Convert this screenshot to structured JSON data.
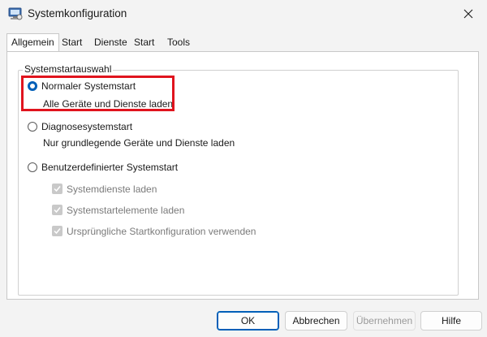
{
  "window": {
    "title": "Systemkonfiguration",
    "icon": "system-config-icon",
    "close_icon": "close-icon"
  },
  "tabs": [
    {
      "label": "Allgemein",
      "active": true
    },
    {
      "label": "Start",
      "active": false
    },
    {
      "label": "Dienste",
      "active": false
    },
    {
      "label": "Start",
      "active": false
    },
    {
      "label": "Tools",
      "active": false
    }
  ],
  "group": {
    "legend": "Systemstartauswahl"
  },
  "options": {
    "normal": {
      "label": "Normaler Systemstart",
      "desc": "Alle Geräte und Dienste laden",
      "selected": true
    },
    "diagnose": {
      "label": "Diagnosesystemstart",
      "desc": "Nur grundlegende Geräte und Dienste laden",
      "selected": false
    },
    "custom": {
      "label": "Benutzerdefinierter Systemstart",
      "selected": false
    }
  },
  "checkboxes": [
    {
      "label": "Systemdienste laden",
      "checked": true,
      "disabled": true
    },
    {
      "label": "Systemstartelemente laden",
      "checked": true,
      "disabled": true
    },
    {
      "label": "Ursprüngliche Startkonfiguration verwenden",
      "checked": true,
      "disabled": true
    }
  ],
  "buttons": {
    "ok": "OK",
    "cancel": "Abbrechen",
    "apply": "Übernehmen",
    "help": "Hilfe"
  },
  "colors": {
    "accent": "#005fb8",
    "highlight": "#e0141e"
  }
}
